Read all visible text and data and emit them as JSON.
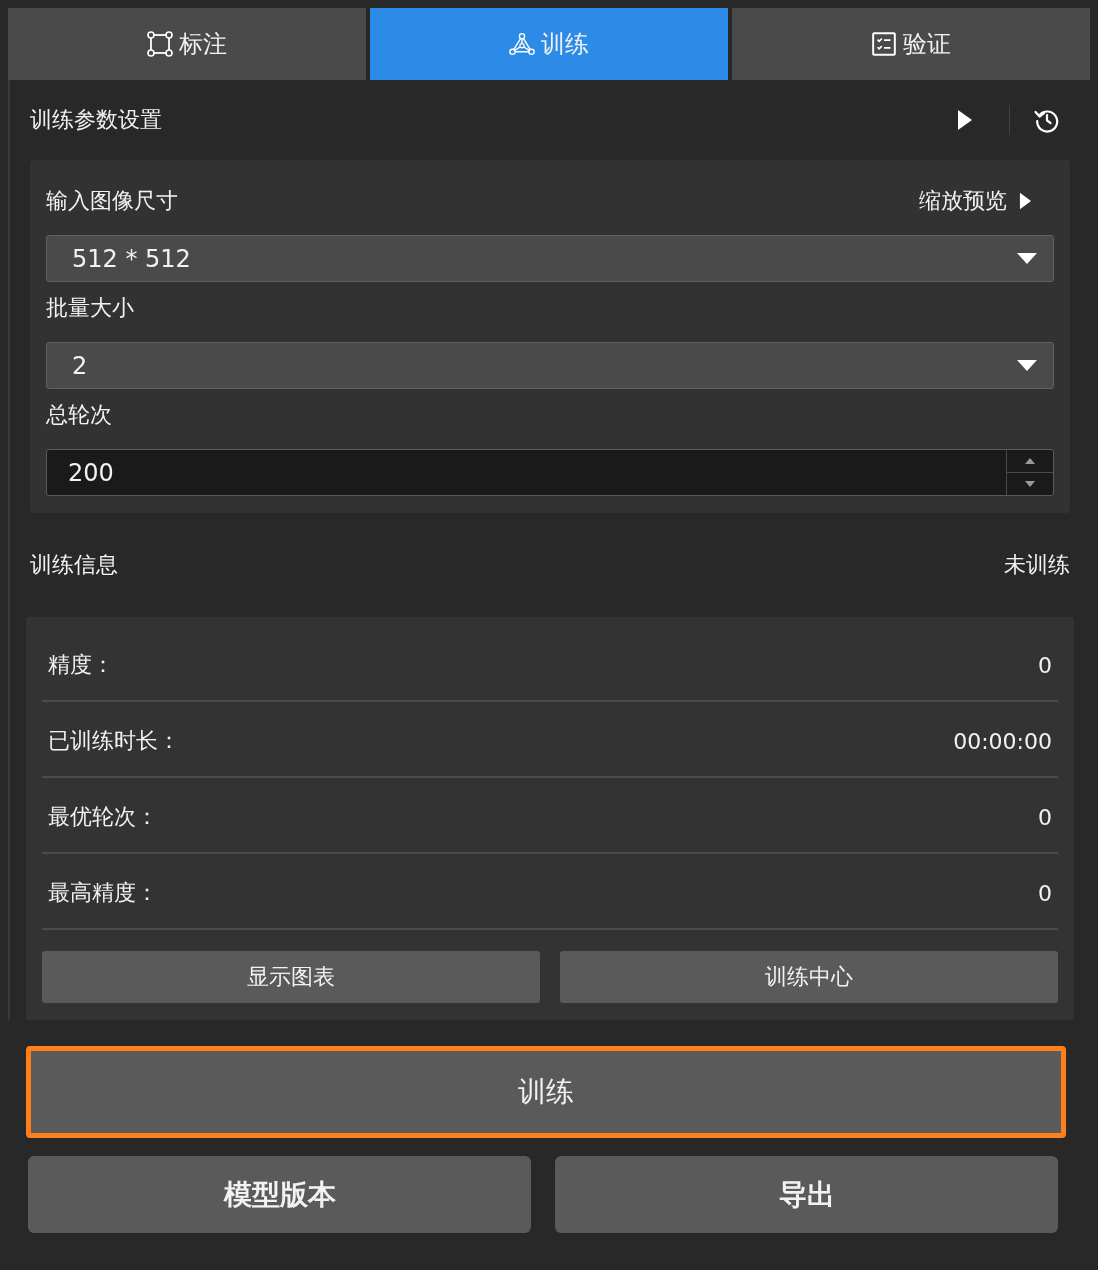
{
  "tabs": [
    {
      "kind": "annotate",
      "label": "标注",
      "selected": false
    },
    {
      "kind": "train",
      "label": "训练",
      "selected": true
    },
    {
      "kind": "validate",
      "label": "验证",
      "selected": false
    }
  ],
  "params": {
    "title": "训练参数设置",
    "fields": [
      {
        "kind": "select",
        "label": "输入图像尺寸",
        "value": "512 * 512",
        "action": "缩放预览"
      },
      {
        "kind": "select",
        "label": "批量大小",
        "value": "2"
      },
      {
        "kind": "spin",
        "label": "总轮次",
        "value": "200"
      }
    ]
  },
  "info": {
    "title": "训练信息",
    "status": "未训练",
    "rows": [
      {
        "label": "精度：",
        "value": "0"
      },
      {
        "label": "已训练时长：",
        "value": "00:00:00"
      },
      {
        "label": "最优轮次：",
        "value": "0"
      },
      {
        "label": "最高精度：",
        "value": "0"
      }
    ],
    "buttons": [
      "显示图表",
      "训练中心"
    ]
  },
  "actions": {
    "primary": {
      "label": "训练",
      "highlighted": true
    },
    "buttons": [
      "模型版本",
      "导出"
    ]
  }
}
